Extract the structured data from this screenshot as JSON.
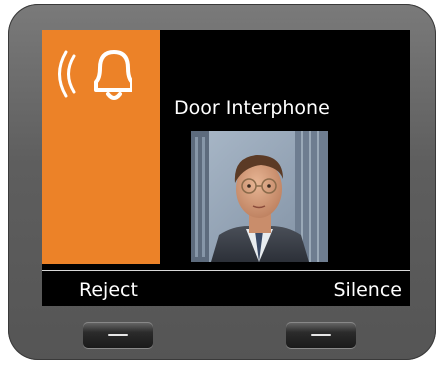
{
  "call": {
    "caller_name": "Door Interphone",
    "status_icon": "ringing-bell-icon",
    "photo": "caller-photo-businessman"
  },
  "softkeys": {
    "left_label": "Reject",
    "right_label": "Silence"
  },
  "colors": {
    "accent": "#ec8228",
    "screen_bg": "#000000",
    "text": "#ffffff"
  }
}
